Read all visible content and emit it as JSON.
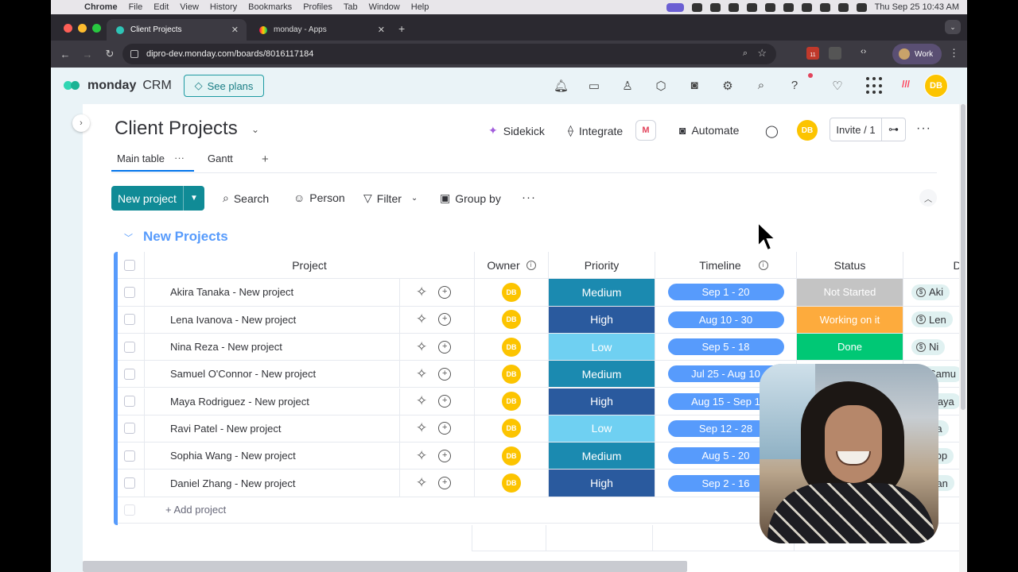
{
  "mac_menu": {
    "app": "Chrome",
    "items": [
      "File",
      "Edit",
      "View",
      "History",
      "Bookmarks",
      "Profiles",
      "Tab",
      "Window",
      "Help"
    ],
    "clock": "Thu Sep 25  10:43 AM"
  },
  "browser": {
    "tabs": [
      {
        "label": "Client Projects",
        "active": true
      },
      {
        "label": "monday - Apps",
        "active": false
      }
    ],
    "url": "dipro-dev.monday.com/boards/8016117184",
    "extension_badge": "11",
    "profile": "Work"
  },
  "app_header": {
    "brand": "monday",
    "product": "CRM",
    "see_plans": "See plans",
    "avatar_initials": "DB",
    "accent_color": "#30d6b3"
  },
  "board": {
    "title": "Client Projects",
    "actions": {
      "sidekick": "Sidekick",
      "integrate": "Integrate",
      "integrate_badge": "M",
      "automate": "Automate",
      "invite": "Invite / 1",
      "avatar_initials": "DB"
    },
    "views": [
      {
        "label": "Main table",
        "active": true
      },
      {
        "label": "Gantt",
        "active": false
      }
    ],
    "toolbar": {
      "new_item": "New project",
      "search": "Search",
      "person": "Person",
      "filter": "Filter",
      "group_by": "Group by"
    },
    "group": {
      "title": "New Projects",
      "color": "#579bfc",
      "columns": [
        "Project",
        "Owner",
        "Priority",
        "Timeline",
        "Status",
        "D"
      ],
      "rows": [
        {
          "project": "Akira Tanaka - New project",
          "owner": "DB",
          "priority": "Medium",
          "timeline": "Sep 1 - 20",
          "status": "Not Started",
          "deal": "Aki"
        },
        {
          "project": "Lena Ivanova - New project",
          "owner": "DB",
          "priority": "High",
          "timeline": "Aug 10 - 30",
          "status": "Working on it",
          "deal": "Len"
        },
        {
          "project": "Nina Reza - New project",
          "owner": "DB",
          "priority": "Low",
          "timeline": "Sep 5 - 18",
          "status": "Done",
          "deal": "Ni"
        },
        {
          "project": "Samuel O'Connor - New project",
          "owner": "DB",
          "priority": "Medium",
          "timeline": "Jul 25 - Aug 10",
          "status": "",
          "deal": "Samu"
        },
        {
          "project": "Maya Rodriguez - New project",
          "owner": "DB",
          "priority": "High",
          "timeline": "Aug 15 - Sep 1",
          "status": "",
          "deal": "Maya"
        },
        {
          "project": "Ravi Patel - New project",
          "owner": "DB",
          "priority": "Low",
          "timeline": "Sep 12 - 28",
          "status": "",
          "deal": "Ra"
        },
        {
          "project": "Sophia Wang - New project",
          "owner": "DB",
          "priority": "Medium",
          "timeline": "Aug 5 - 20",
          "status": "",
          "deal": "Sop"
        },
        {
          "project": "Daniel Zhang - New project",
          "owner": "DB",
          "priority": "High",
          "timeline": "Sep 2 - 16",
          "status": "",
          "deal": "Dan"
        }
      ],
      "add_item": "+ Add project"
    }
  },
  "colors": {
    "priority": {
      "Medium": "#1b8ab0",
      "High": "#2a5a9e",
      "Low": "#6fd0f2"
    },
    "status": {
      "Not Started": "#c4c4c4",
      "Working on it": "#fdab3d",
      "Done": "#00c875"
    },
    "timeline": "#579bfc",
    "primary_button": "#108b96"
  }
}
